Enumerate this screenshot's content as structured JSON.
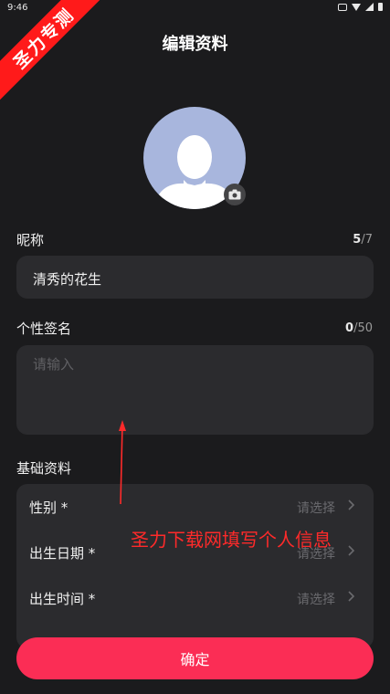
{
  "status_bar": {
    "time": "9:46"
  },
  "watermark": {
    "ribbon_text": "圣力专测",
    "overlay_text": "圣力下载网填写个人信息"
  },
  "header": {
    "title": "编辑资料"
  },
  "nickname": {
    "label": "昵称",
    "value": "清秀的花生",
    "count_current": "5",
    "count_max": "/7"
  },
  "signature": {
    "label": "个性签名",
    "placeholder": "请输入",
    "count_current": "0",
    "count_max": "/50"
  },
  "basic_info": {
    "label": "基础资料",
    "rows": [
      {
        "label": "性别 *",
        "value": "请选择"
      },
      {
        "label": "出生日期 *",
        "value": "请选择"
      },
      {
        "label": "出生时间 *",
        "value": "请选择"
      }
    ]
  },
  "actions": {
    "confirm_label": "确定"
  },
  "colors": {
    "background": "#1b1b1d",
    "card": "#2b2b2e",
    "accent": "#fb2d55",
    "watermark_red": "#ff1a1a",
    "avatar_bg": "#a8b6dd"
  }
}
